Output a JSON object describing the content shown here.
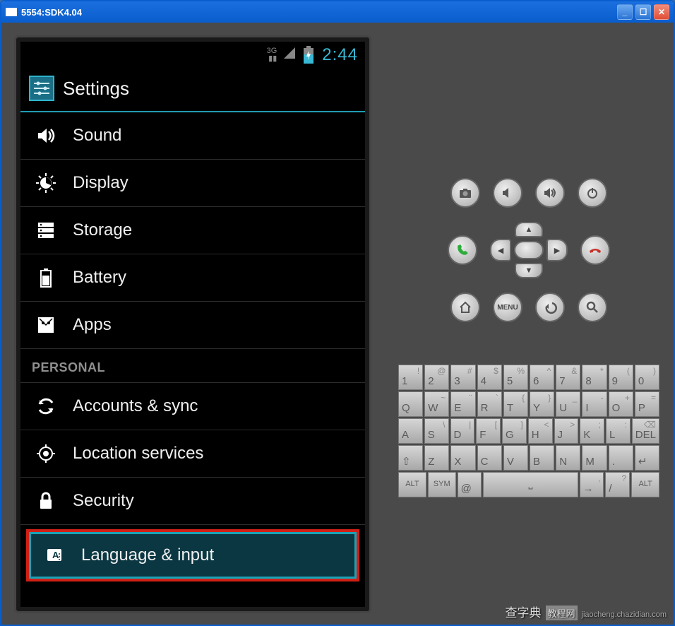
{
  "window": {
    "title": "5554:SDK4.04"
  },
  "statusbar": {
    "network": "3G",
    "time": "2:44"
  },
  "app": {
    "title": "Settings",
    "section_personal": "PERSONAL",
    "items": [
      {
        "icon": "sound",
        "label": "Sound"
      },
      {
        "icon": "display",
        "label": "Display"
      },
      {
        "icon": "storage",
        "label": "Storage"
      },
      {
        "icon": "battery",
        "label": "Battery"
      },
      {
        "icon": "apps",
        "label": "Apps"
      }
    ],
    "personal_items": [
      {
        "icon": "sync",
        "label": "Accounts & sync"
      },
      {
        "icon": "location",
        "label": "Location services"
      },
      {
        "icon": "security",
        "label": "Security"
      },
      {
        "icon": "language",
        "label": "Language & input",
        "highlight": true
      }
    ]
  },
  "hw": {
    "menu_label": "MENU"
  },
  "keyboard": {
    "r1": [
      {
        "k": "1",
        "s": "!"
      },
      {
        "k": "2",
        "s": "@"
      },
      {
        "k": "3",
        "s": "#"
      },
      {
        "k": "4",
        "s": "$"
      },
      {
        "k": "5",
        "s": "%"
      },
      {
        "k": "6",
        "s": "^"
      },
      {
        "k": "7",
        "s": "&"
      },
      {
        "k": "8",
        "s": "*"
      },
      {
        "k": "9",
        "s": "("
      },
      {
        "k": "0",
        "s": ")"
      }
    ],
    "r2": [
      {
        "k": "Q"
      },
      {
        "k": "W",
        "s": "~"
      },
      {
        "k": "E",
        "s": "¨"
      },
      {
        "k": "R",
        "s": "`"
      },
      {
        "k": "T",
        "s": "{"
      },
      {
        "k": "Y",
        "s": "}"
      },
      {
        "k": "U",
        "s": "_"
      },
      {
        "k": "I",
        "s": "-"
      },
      {
        "k": "O",
        "s": "+"
      },
      {
        "k": "P",
        "s": "="
      }
    ],
    "r3": [
      {
        "k": "A"
      },
      {
        "k": "S",
        "s": "\\"
      },
      {
        "k": "D",
        "s": "|"
      },
      {
        "k": "F",
        "s": "["
      },
      {
        "k": "G",
        "s": "]"
      },
      {
        "k": "H",
        "s": "<"
      },
      {
        "k": "J",
        "s": ">"
      },
      {
        "k": "K",
        "s": ";"
      },
      {
        "k": "L",
        "s": ":"
      },
      {
        "k": "DEL",
        "s": "⌫"
      }
    ],
    "r4": [
      {
        "k": "⇧"
      },
      {
        "k": "Z"
      },
      {
        "k": "X"
      },
      {
        "k": "C"
      },
      {
        "k": "V"
      },
      {
        "k": "B"
      },
      {
        "k": "N"
      },
      {
        "k": "M"
      },
      {
        "k": "."
      },
      {
        "k": "↵"
      }
    ],
    "r5": {
      "alt": "ALT",
      "sym": "SYM",
      "at": "@",
      "comma": ",",
      "slash": "/",
      "q": "?"
    }
  },
  "watermark": {
    "main": "查字典",
    "tag": "教程网",
    "url": "jiaocheng.chazidian.com"
  }
}
